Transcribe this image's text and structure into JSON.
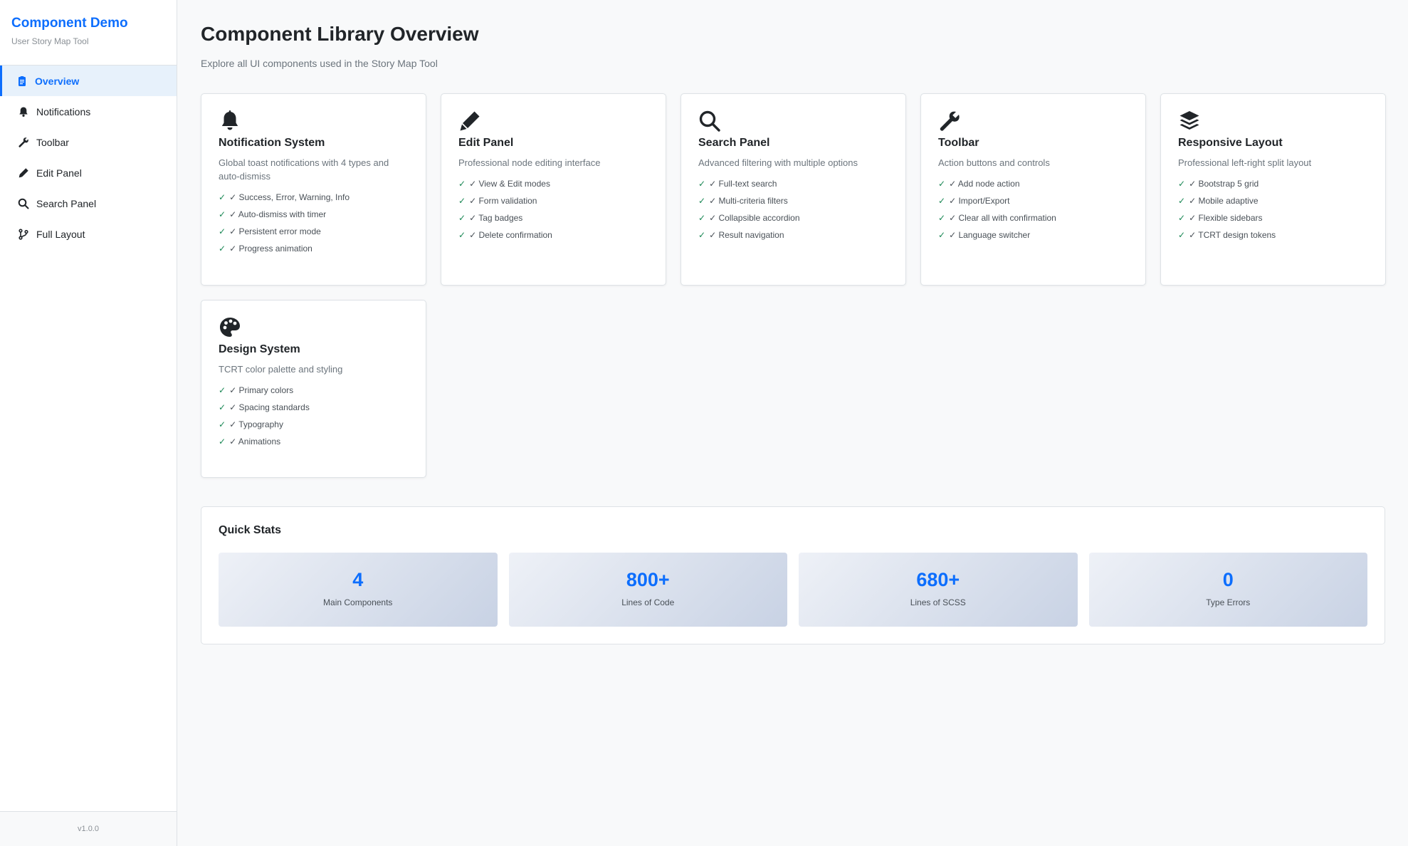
{
  "sidebar": {
    "brand_title": "Component Demo",
    "brand_subtitle": "User Story Map Tool",
    "items": [
      {
        "label": "Overview",
        "icon": "clipboard-icon",
        "active": true
      },
      {
        "label": "Notifications",
        "icon": "bell-icon"
      },
      {
        "label": "Toolbar",
        "icon": "wrench-icon"
      },
      {
        "label": "Edit Panel",
        "icon": "pencil-icon"
      },
      {
        "label": "Search Panel",
        "icon": "search-icon"
      },
      {
        "label": "Full Layout",
        "icon": "git-branch-icon"
      }
    ],
    "version": "v1.0.0"
  },
  "main": {
    "title": "Component Library Overview",
    "subtitle": "Explore all UI components used in the Story Map Tool",
    "cards": [
      {
        "icon": "bell-icon",
        "title": "Notification System",
        "description": "Global toast notifications with 4 types and auto-dismiss",
        "features": [
          "✓ Success, Error, Warning, Info",
          "✓ Auto-dismiss with timer",
          "✓ Persistent error mode",
          "✓ Progress animation"
        ]
      },
      {
        "icon": "pencil-icon",
        "title": "Edit Panel",
        "description": "Professional node editing interface",
        "features": [
          "✓ View & Edit modes",
          "✓ Form validation",
          "✓ Tag badges",
          "✓ Delete confirmation"
        ]
      },
      {
        "icon": "search-icon",
        "title": "Search Panel",
        "description": "Advanced filtering with multiple options",
        "features": [
          "✓ Full-text search",
          "✓ Multi-criteria filters",
          "✓ Collapsible accordion",
          "✓ Result navigation"
        ]
      },
      {
        "icon": "wrench-icon",
        "title": "Toolbar",
        "description": "Action buttons and controls",
        "features": [
          "✓ Add node action",
          "✓ Import/Export",
          "✓ Clear all with confirmation",
          "✓ Language switcher"
        ]
      },
      {
        "icon": "layers-icon",
        "title": "Responsive Layout",
        "description": "Professional left-right split layout",
        "features": [
          "✓ Bootstrap 5 grid",
          "✓ Mobile adaptive",
          "✓ Flexible sidebars",
          "✓ TCRT design tokens"
        ]
      },
      {
        "icon": "palette-icon",
        "title": "Design System",
        "description": "TCRT color palette and styling",
        "features": [
          "✓ Primary colors",
          "✓ Spacing standards",
          "✓ Typography",
          "✓ Animations"
        ]
      }
    ],
    "stats": {
      "title": "Quick Stats",
      "items": [
        {
          "value": "4",
          "label": "Main Components"
        },
        {
          "value": "800+",
          "label": "Lines of Code"
        },
        {
          "value": "680+",
          "label": "Lines of SCSS"
        },
        {
          "value": "0",
          "label": "Type Errors"
        }
      ]
    }
  },
  "colors": {
    "primary": "#0d6efd",
    "check": "#198754",
    "active_bg": "#e7f1fb"
  }
}
